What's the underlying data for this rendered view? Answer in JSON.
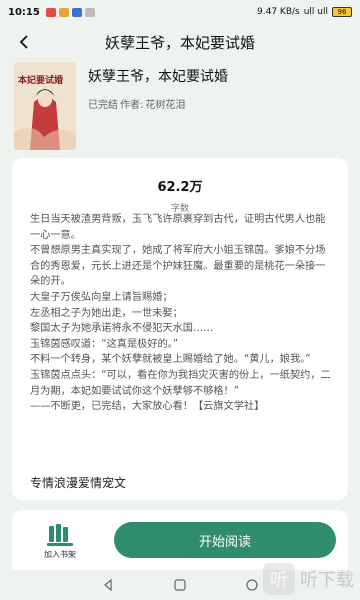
{
  "status_bar": {
    "time": "10:15",
    "network": "9.47 KB/s",
    "signal": "ull ull",
    "battery": "96"
  },
  "header": {
    "title": "妖孽王爷，本妃要试婚"
  },
  "book": {
    "title": "妖孽王爷，本妃要试婚",
    "status": "已完结",
    "author_prefix": "作者:",
    "author": "花树花泪",
    "cover_text": "本妃要试婚"
  },
  "stats": {
    "word_count": "62.2万",
    "word_unit": "万",
    "word_label": "字数"
  },
  "intro": "生日当天被渣男背叛，玉飞飞许原裹穿到古代，证明古代男人也能一心一意。\n不曾想原男主真实现了，她成了将军府大小姐玉锦茵。爹娘不分场合的秀恩爱，元长上进还是个护妹狂魔。最重要的是桃花一朵接一朵的开。\n大皇子万俟弘向皇上请旨赐婚；\n左丞相之子为她出走，一世未娶；\n黎国太子为她承诺将永不侵犯天水国……\n玉锦茵感叹道：“这真是极好的。”\n不料一个转身，某个妖孽就被皇上赐婚给了她。“黄儿，娘我。”\n玉锦茵点点头：“可以，看在你为我挡灾灭害的份上，一纸契约，二月为期，本妃如要试试你这个妖孽够不够格！”\n——不断更，已完结，大家放心看！【云旗文学社】",
  "tag_line": "专情浪漫爱情宠文",
  "actions": {
    "shelf_label": "加入书架",
    "read_label": "开始阅读"
  },
  "watermark": {
    "text": "听下载",
    "glyph": "听"
  },
  "colors": {
    "accent": "#2f8c6f",
    "background": "#eef3ef"
  },
  "icons": [
    "back-arrow-icon",
    "bookshelf-icon",
    "nav-back-icon",
    "nav-home-icon",
    "nav-recents-icon"
  ]
}
